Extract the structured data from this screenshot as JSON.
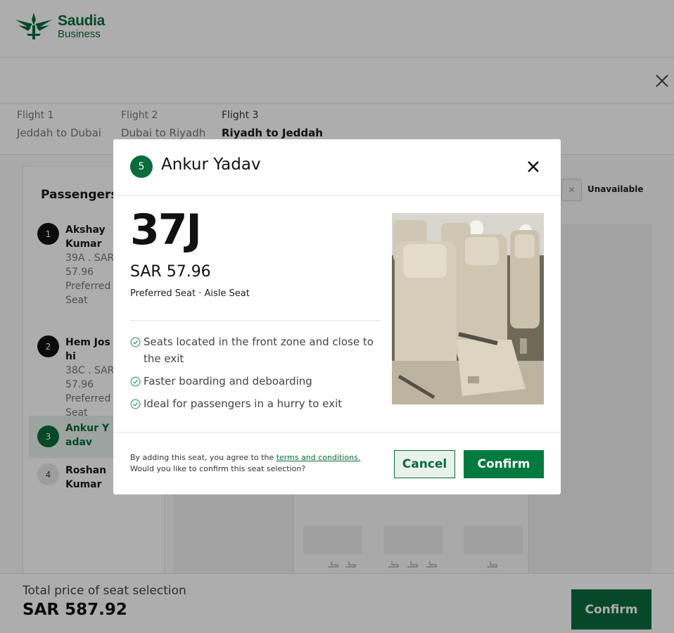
{
  "brand": {
    "line1": "Saudia",
    "line2": "Business",
    "color": "#0a6b3c"
  },
  "flights": [
    {
      "label": "Flight 1",
      "route": "Jeddah to Dubai",
      "active": false
    },
    {
      "label": "Flight 2",
      "route": "Dubai to Riyadh",
      "active": false
    },
    {
      "label": "Flight 3",
      "route": "Riyadh to Jeddah",
      "active": true
    }
  ],
  "passengers_panel": {
    "title": "Passengers",
    "items": [
      {
        "number": "1",
        "name": "Akshay Kumar",
        "seat_info": "39A . SAR 57.96 Preferred Seat",
        "state": "assigned"
      },
      {
        "number": "2",
        "name": "Hem Joshi",
        "seat_info": "38C . SAR 57.96 Preferred Seat",
        "state": "assigned"
      },
      {
        "number": "3",
        "name": "Ankur Yadav",
        "seat_info": "",
        "state": "current"
      },
      {
        "number": "4",
        "name": "Roshan Kumar",
        "seat_info": "",
        "state": "pending"
      }
    ]
  },
  "legend": {
    "unavailable_label": "Unavailable",
    "unavailable_symbol": "✕"
  },
  "footer": {
    "total_label": "Total price of seat selection",
    "total_value": "SAR 587.92",
    "confirm_label": "Confirm"
  },
  "modal": {
    "badge_number": "5",
    "passenger_name": "Ankur Yadav",
    "seat_code": "37J",
    "price": "SAR 57.96",
    "seat_type": "Preferred Seat · Aisle Seat",
    "features": [
      "Seats located in the front zone and close to the exit",
      "Faster boarding and deboarding",
      "Ideal for passengers in a hurry to exit"
    ],
    "agreement_prefix": "By adding this seat, you agree to the",
    "agreement_link": "terms and conditions.",
    "agreement_question": "Would you like to confirm this seat selection?",
    "cancel_label": "Cancel",
    "confirm_label": "Confirm"
  },
  "colors": {
    "primary": "#0a6b3c",
    "confirm_button": "#007a3e",
    "check": "#2e9e58"
  },
  "icons": {
    "close": "close-icon",
    "check": "check-circle-icon",
    "logo": "saudia-palm-logo"
  }
}
